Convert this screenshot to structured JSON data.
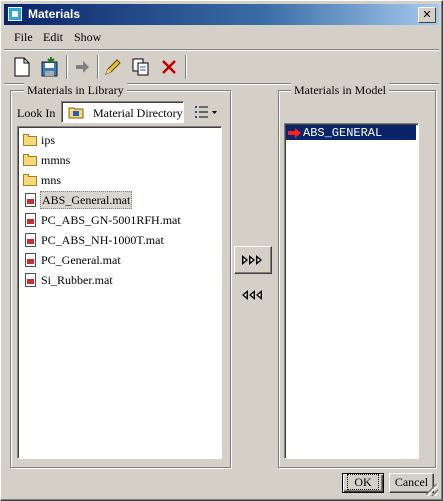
{
  "window": {
    "title": "Materials",
    "close_glyph": "✕"
  },
  "menu": {
    "items": [
      "File",
      "Edit",
      "Show"
    ]
  },
  "toolbar": {
    "buttons": [
      "new-material-icon",
      "save-material-icon",
      "assign-arrow-icon",
      "edit-pencil-icon",
      "copy-icon",
      "delete-x-icon"
    ]
  },
  "library": {
    "legend": "Materials in Library",
    "look_in_label": "Look In",
    "look_in_value": "Material Directory",
    "files": [
      {
        "name": "ips",
        "type": "folder"
      },
      {
        "name": "mmns",
        "type": "folder"
      },
      {
        "name": "mns",
        "type": "folder"
      },
      {
        "name": "ABS_General.mat",
        "type": "material",
        "selected": true
      },
      {
        "name": "PC_ABS_GN-5001RFH.mat",
        "type": "material"
      },
      {
        "name": "PC_ABS_NH-1000T.mat",
        "type": "material"
      },
      {
        "name": "PC_General.mat",
        "type": "material"
      },
      {
        "name": "Si_Rubber.mat",
        "type": "material"
      }
    ]
  },
  "model": {
    "legend": "Materials in Model",
    "items": [
      "ABS_GENERAL"
    ]
  },
  "buttons": {
    "ok": "OK",
    "cancel": "Cancel"
  },
  "colors": {
    "titlebar_start": "#0a246a",
    "selection": "#0a246a",
    "dialog_bg": "#d4d0c8"
  }
}
